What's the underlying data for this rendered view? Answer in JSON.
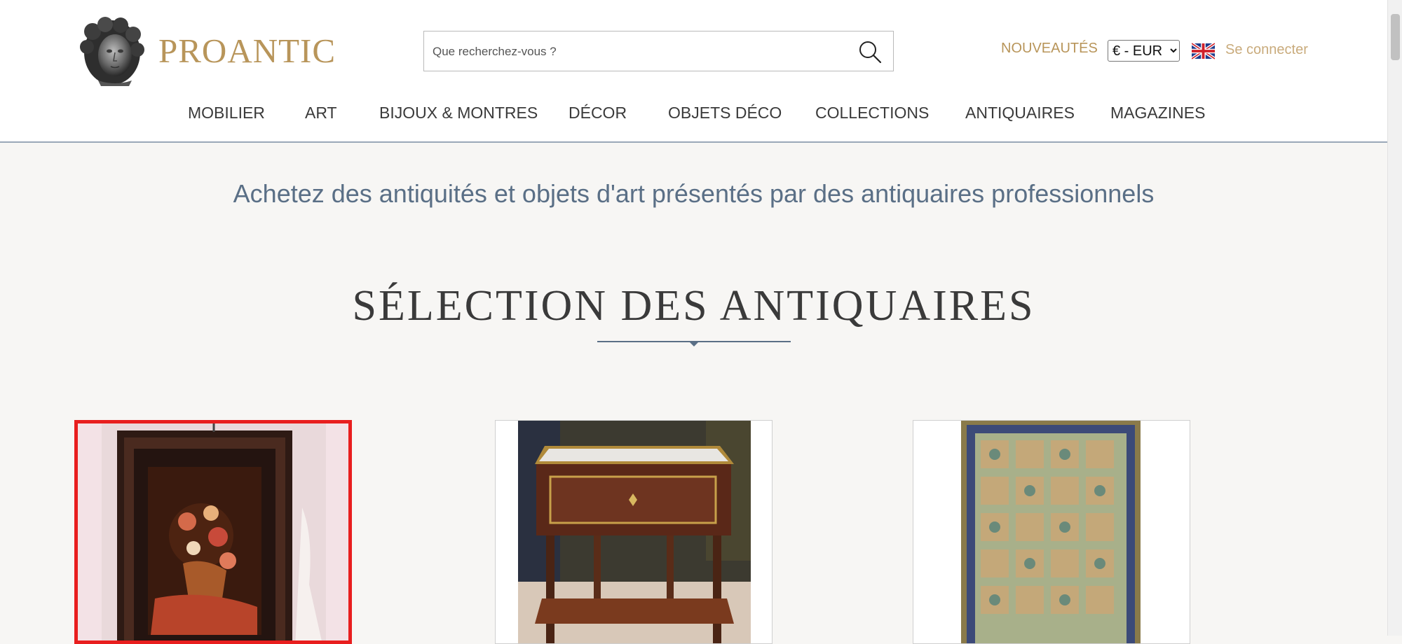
{
  "brand": {
    "name": "PROANTIC"
  },
  "search": {
    "placeholder": "Que recherchez-vous ?"
  },
  "header_links": {
    "nouveautes": "NOUVEAUTÉS",
    "currency_selected": "€ - EUR",
    "connect": "Se connecter"
  },
  "nav": {
    "items": [
      {
        "label": "MOBILIER"
      },
      {
        "label": "ART"
      },
      {
        "label": "BIJOUX & MONTRES"
      },
      {
        "label": "DÉCOR"
      },
      {
        "label": "OBJETS DÉCO"
      },
      {
        "label": "COLLECTIONS"
      },
      {
        "label": "ANTIQUAIRES"
      },
      {
        "label": "MAGAZINES"
      }
    ]
  },
  "main": {
    "tagline": "Achetez des antiquités et objets d'art présentés par des antiquaires professionnels",
    "section_title": "SÉLECTION DES ANTIQUAIRES",
    "cards": [
      {
        "subject": "framed floral still-life painting",
        "highlighted": true
      },
      {
        "subject": "marble-top side table"
      },
      {
        "subject": "oriental rug"
      }
    ]
  },
  "colors": {
    "brand_gold": "#b8955a",
    "link_gold": "#c9ab7c",
    "slate_blue": "#5a6f86",
    "highlight_red": "#e81e1e",
    "background": "#f7f6f4"
  },
  "icons": [
    "sculpted-head-logo-icon",
    "search-icon",
    "uk-flag-icon",
    "chevron-down-icon"
  ]
}
